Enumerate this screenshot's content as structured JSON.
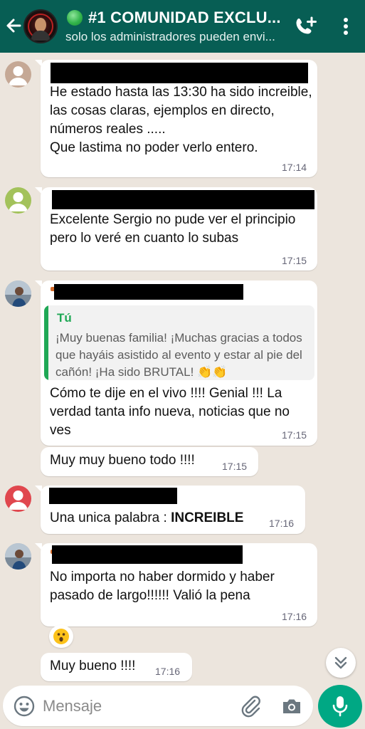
{
  "header": {
    "title": "#1 COMUNIDAD EXCLU...",
    "subtitle": "solo los administradores pueden envi..."
  },
  "messages": [
    {
      "text": "He estado hasta las 13:30 ha sido increible, las cosas claras, ejemplos en directo, números reales .....\nQue lastima no poder verlo entero.",
      "time": "17:14"
    },
    {
      "text": "Excelente Sergio no pude ver el principio pero lo veré en cuanto lo subas",
      "time": "17:15"
    },
    {
      "quote_author": "Tú",
      "quote_text": "¡Muy buenas familia! ¡Muchas gracias a todos que hayáis asistido al evento y estar al pie del cañón! ¡Ha sido BRUTAL! 👏👏",
      "text": "Cómo te dije en el vivo !!!! Genial !!! La verdad tanta info nueva, noticias que no ves",
      "time": "17:15"
    },
    {
      "text": "Muy muy bueno todo !!!!",
      "time": "17:15"
    },
    {
      "text_prefix": "Una unica palabra : ",
      "text_bold": "INCREIBLE",
      "time": "17:16"
    },
    {
      "text": "No importa no haber dormido y haber pasado de largo!!!!!! Valió la pena",
      "time": "17:16"
    },
    {
      "text": "Muy bueno !!!!",
      "time": "17:16"
    }
  ],
  "input": {
    "placeholder": "Mensaje"
  },
  "colors": {
    "header": "#075e54",
    "background": "#ece5dd",
    "quote_accent": "#1fa855",
    "mic": "#00a884"
  },
  "icons": [
    "back-arrow-icon",
    "add-call-icon",
    "more-vert-icon",
    "emoji-icon",
    "paperclip-icon",
    "camera-icon",
    "mic-icon",
    "chevrons-down-icon"
  ]
}
